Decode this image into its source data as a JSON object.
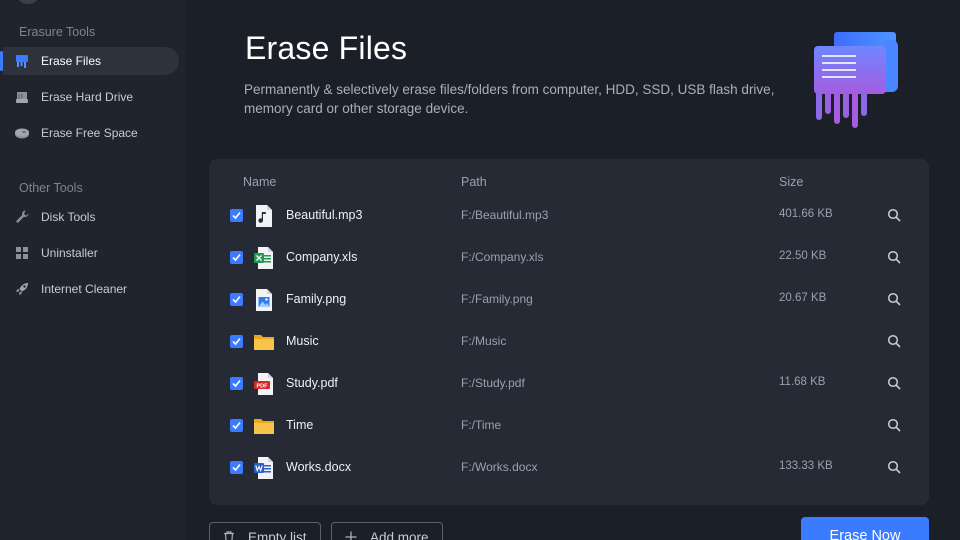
{
  "sidebar": {
    "sections": [
      {
        "title": "Erasure Tools",
        "items": [
          {
            "label": "Erase Files",
            "icon": "erase-files-icon",
            "active": true
          },
          {
            "label": "Erase Hard Drive",
            "icon": "hard-drive-icon",
            "active": false
          },
          {
            "label": "Erase Free Space",
            "icon": "free-space-icon",
            "active": false
          }
        ]
      },
      {
        "title": "Other Tools",
        "items": [
          {
            "label": "Disk Tools",
            "icon": "wrench-icon",
            "active": false
          },
          {
            "label": "Uninstaller",
            "icon": "apps-grid-icon",
            "active": false
          },
          {
            "label": "Internet Cleaner",
            "icon": "rocket-icon",
            "active": false
          }
        ]
      }
    ]
  },
  "header": {
    "title": "Erase Files",
    "description": "Permanently & selectively erase files/folders from computer, HDD, SSD, USB flash drive, memory card or other storage device."
  },
  "table": {
    "columns": {
      "name": "Name",
      "path": "Path",
      "size": "Size"
    },
    "rows": [
      {
        "name": "Beautiful.mp3",
        "path": "F:/Beautiful.mp3",
        "size": "401.66 KB",
        "type": "audio",
        "checked": true
      },
      {
        "name": "Company.xls",
        "path": "F:/Company.xls",
        "size": "22.50 KB",
        "type": "excel",
        "checked": true
      },
      {
        "name": "Family.png",
        "path": "F:/Family.png",
        "size": "20.67 KB",
        "type": "image",
        "checked": true
      },
      {
        "name": "Music",
        "path": "F:/Music",
        "size": "",
        "type": "folder",
        "checked": true
      },
      {
        "name": "Study.pdf",
        "path": "F:/Study.pdf",
        "size": "11.68 KB",
        "type": "pdf",
        "checked": true
      },
      {
        "name": "Time",
        "path": "F:/Time",
        "size": "",
        "type": "folder",
        "checked": true
      },
      {
        "name": "Works.docx",
        "path": "F:/Works.docx",
        "size": "133.33 KB",
        "type": "word",
        "checked": true
      }
    ]
  },
  "actions": {
    "empty_list": "Empty list",
    "add_more": "Add more",
    "erase_now": "Erase Now"
  },
  "colors": {
    "accent": "#3b7bff",
    "background": "#1b1f28",
    "sidebar": "#20242d",
    "panel": "#252a34"
  }
}
